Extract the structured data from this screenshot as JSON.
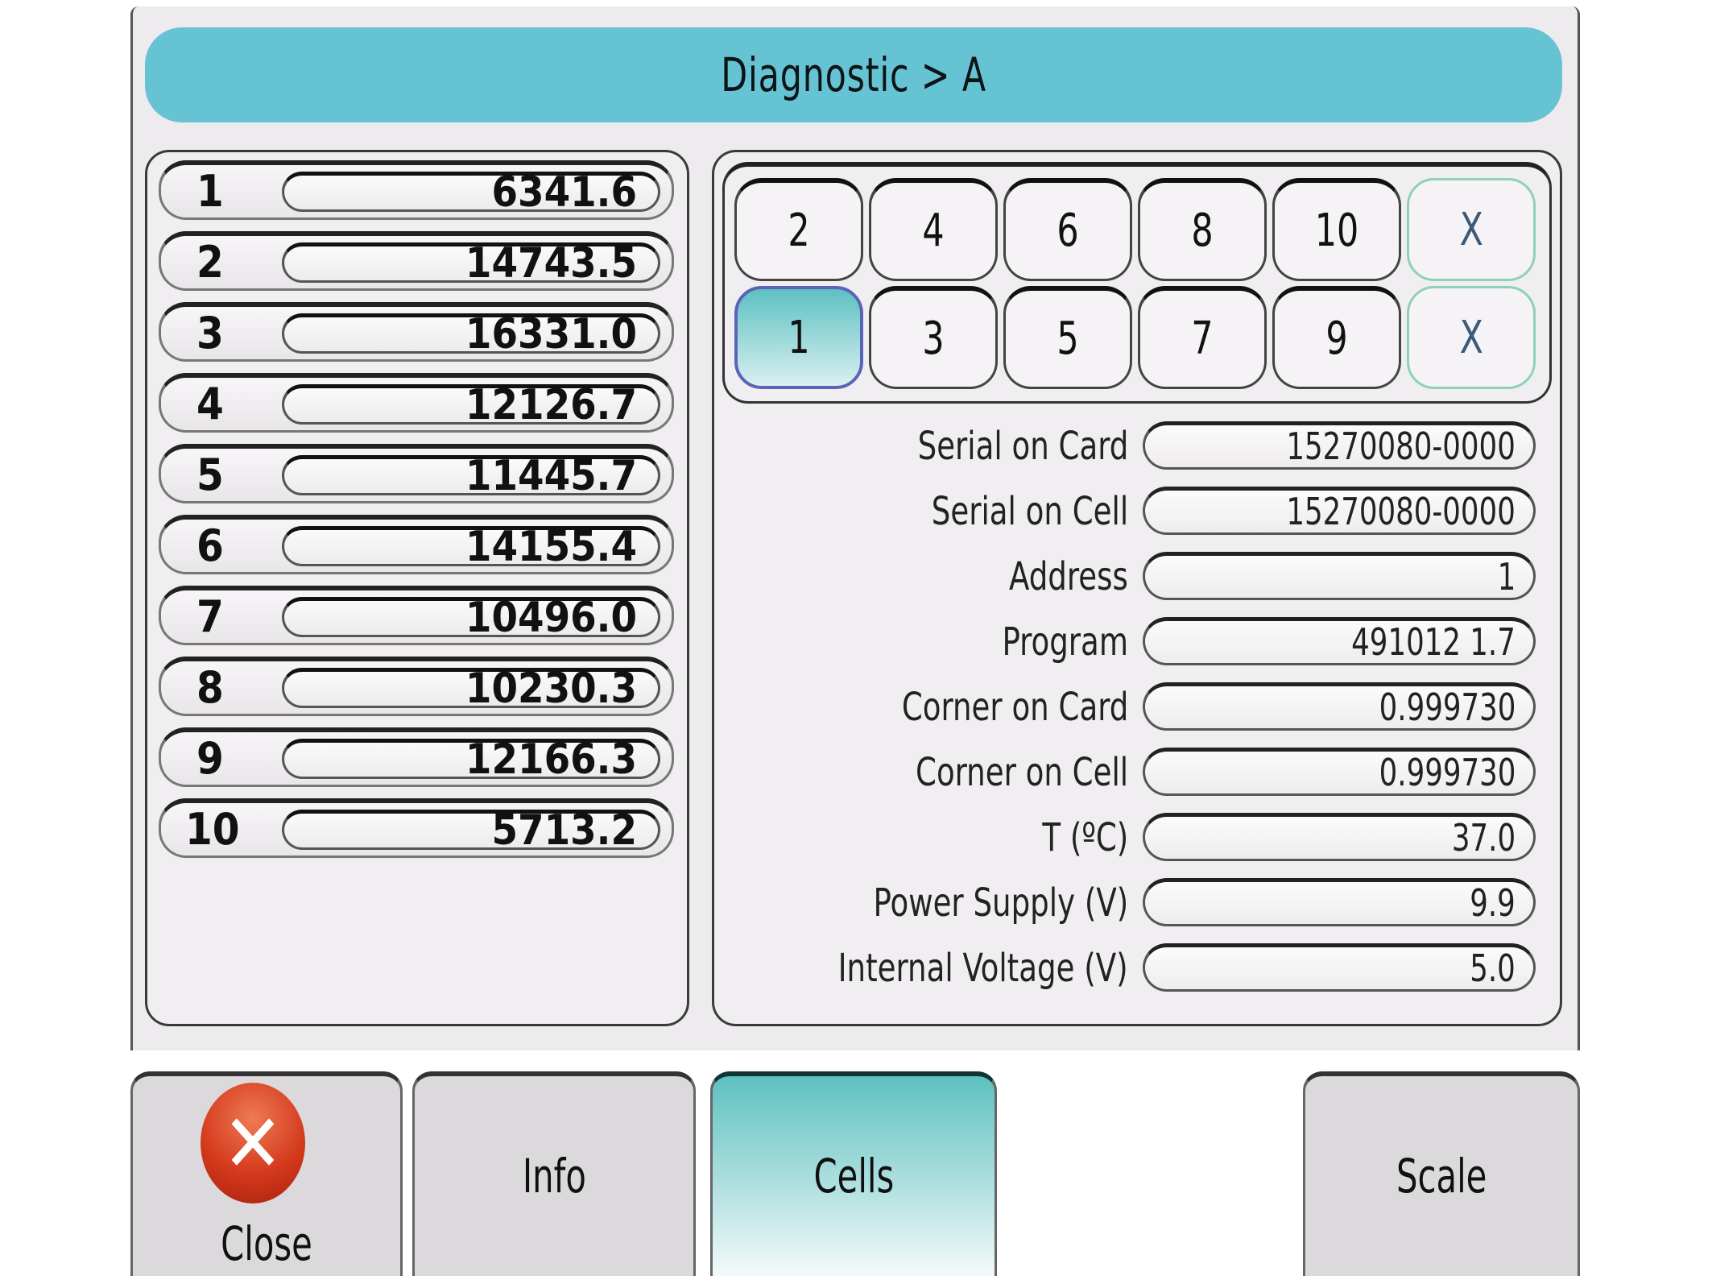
{
  "window": {
    "title": "Diagnostic > A"
  },
  "cells": [
    {
      "index": "1",
      "value": "6341.6"
    },
    {
      "index": "2",
      "value": "14743.5"
    },
    {
      "index": "3",
      "value": "16331.0"
    },
    {
      "index": "4",
      "value": "12126.7"
    },
    {
      "index": "5",
      "value": "11445.7"
    },
    {
      "index": "6",
      "value": "14155.4"
    },
    {
      "index": "7",
      "value": "10496.0"
    },
    {
      "index": "8",
      "value": "10230.3"
    },
    {
      "index": "9",
      "value": "12166.3"
    },
    {
      "index": "10",
      "value": "5713.2"
    }
  ],
  "cell_selector": {
    "top_row": [
      "2",
      "4",
      "6",
      "8",
      "10",
      "X"
    ],
    "bottom_row": [
      "1",
      "3",
      "5",
      "7",
      "9",
      "X"
    ],
    "selected": "1"
  },
  "properties": [
    {
      "label": "Serial on Card",
      "value": "15270080-0000"
    },
    {
      "label": "Serial on Cell",
      "value": "15270080-0000"
    },
    {
      "label": "Address",
      "value": "1"
    },
    {
      "label": "Program",
      "value": "491012 1.7"
    },
    {
      "label": "Corner on Card",
      "value": "0.999730"
    },
    {
      "label": "Corner on Cell",
      "value": "0.999730"
    },
    {
      "label": "T (ºC)",
      "value": "37.0"
    },
    {
      "label": "Power Supply (V)",
      "value": "9.9"
    },
    {
      "label": "Internal Voltage (V)",
      "value": "5.0"
    }
  ],
  "toolbar": {
    "close_label": "Close",
    "close_icon": "close-icon",
    "info_label": "Info",
    "cells_label": "Cells",
    "scale_label": "Scale",
    "active_tab": "Cells"
  },
  "colors": {
    "accent": "#66c3d4",
    "selected": "#5ec0c2",
    "close_red": "#d43a1c"
  }
}
